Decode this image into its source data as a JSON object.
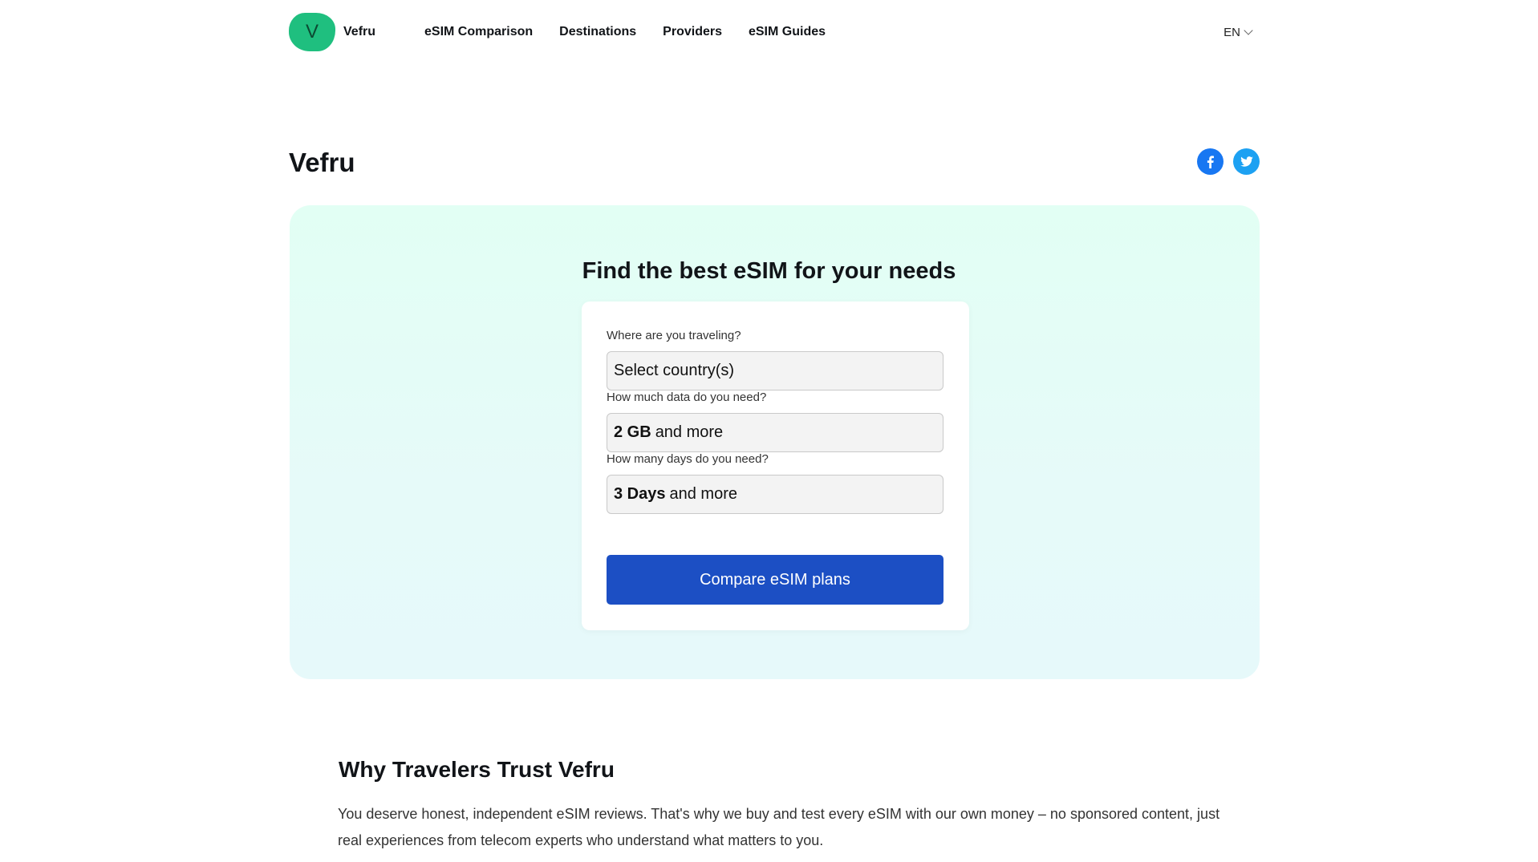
{
  "header": {
    "logo_letter": "V",
    "brand_name": "Vefru",
    "nav": [
      {
        "label": "eSIM Comparison"
      },
      {
        "label": "Destinations"
      },
      {
        "label": "Providers"
      },
      {
        "label": "eSIM Guides"
      }
    ],
    "language": "EN"
  },
  "page": {
    "title": "Vefru",
    "social": [
      {
        "icon": "facebook-icon",
        "color": "#1877f2"
      },
      {
        "icon": "twitter-icon",
        "color": "#1da1f2"
      }
    ]
  },
  "finder": {
    "heading": "Find the best eSIM for your needs",
    "destination": {
      "label": "Where are you traveling?",
      "placeholder": "Select country(s)"
    },
    "data": {
      "label": "How much data do you need?",
      "value_bold": "2 GB",
      "value_rest": "and more"
    },
    "days": {
      "label": "How many days do you need?",
      "value_bold": "3 Days",
      "value_rest": "and more"
    },
    "cta_label": "Compare eSIM plans"
  },
  "trust": {
    "heading": "Why Travelers Trust Vefru",
    "body": "You deserve honest, independent eSIM reviews. That's why we buy and test every eSIM with our own money – no sponsored content, just real experiences from telecom experts who understand what matters to you."
  },
  "colors": {
    "brand_green": "#1fbf7f",
    "cta_blue": "#1c4fc4",
    "hero_background": "#e4fcf6"
  }
}
